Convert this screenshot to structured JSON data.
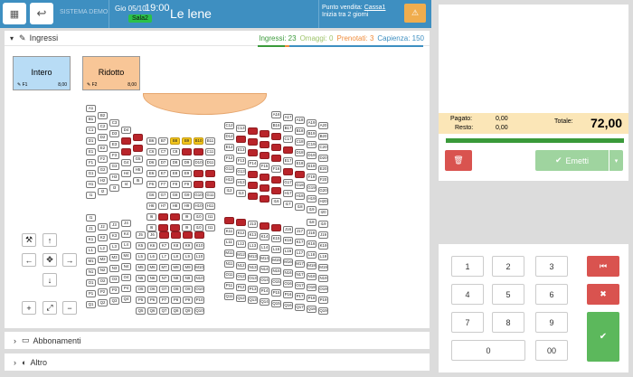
{
  "header": {
    "system_label": "SISTEMA DEMO",
    "date": "Gio 05/10",
    "time": "19:00",
    "sala": "Sala2",
    "film": "Le lene",
    "pv_label": "Punto vendita:",
    "pv_name": "Cassa1",
    "pv_sub": "Inizia tra 2 giorni"
  },
  "ingressi": {
    "title": "Ingressi",
    "stats": [
      {
        "label": "Ingressi: 23",
        "color": "#3a9a3a"
      },
      {
        "label": "Omaggi: 0",
        "color": "#9fc46b"
      },
      {
        "label": "Prenotati: 3",
        "color": "#ef8b3a"
      },
      {
        "label": "Capienza: 150",
        "color": "#3e8fc1"
      }
    ]
  },
  "tickets": [
    {
      "name": "Intero",
      "code": "F1",
      "price": "8,00",
      "color": "#b8dcf5"
    },
    {
      "name": "Ridotto",
      "code": "F2",
      "price": "8,00",
      "color": "#f8c697"
    }
  ],
  "accordion": [
    {
      "label": "Abbonamenti"
    },
    {
      "label": "Altro"
    }
  ],
  "payment": {
    "pagato_label": "Pagato:",
    "pagato": "0,00",
    "resto_label": "Resto:",
    "resto": "0,00",
    "totale_label": "Totale:",
    "totale": "72,00",
    "emetti": "Emetti"
  },
  "keypad": [
    "1",
    "2",
    "3",
    "4",
    "5",
    "6",
    "7",
    "8",
    "9",
    "0",
    "00"
  ],
  "seat_statuses": {
    "red": [
      "C4",
      "C5",
      "E4",
      "E5",
      "F4",
      "F5",
      "I7",
      "I8",
      "J7",
      "J8",
      "C9",
      "C10",
      "E10",
      "E11",
      "F10",
      "F11",
      "I14",
      "I15",
      "J14",
      "J15",
      "C14",
      "C15",
      "C16",
      "E14",
      "E15",
      "E16",
      "G14",
      "G15",
      "G16",
      "H14",
      "H15",
      "H16",
      "D13",
      "D14",
      "D15",
      "D16",
      "D17",
      "F17",
      "F18",
      "J9",
      "J10",
      "J11",
      "J12"
    ],
    "yellow": [
      "B8",
      "B9",
      "B10"
    ]
  }
}
